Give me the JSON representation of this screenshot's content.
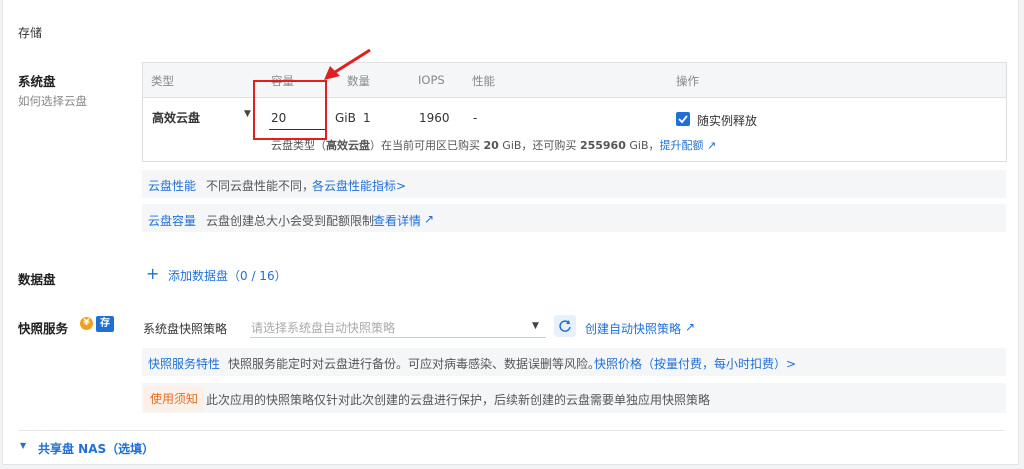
{
  "section": {
    "title": "存储"
  },
  "system_disk": {
    "label": "系统盘",
    "help_link": "如何选择云盘",
    "table": {
      "headers": [
        "类型",
        "容量",
        "数量",
        "IOPS",
        "性能",
        "操作"
      ],
      "row": {
        "type": "高效云盘",
        "capacity": "20",
        "unit": "GiB",
        "count": "1",
        "iops": "1960",
        "performance": "-",
        "release_checkbox_label": "随实例释放",
        "release_checked": true
      },
      "quota_text_prefix": "云盘类型（",
      "quota_disk_type": "高效云盘",
      "quota_text_mid1": "）在当前可用区已购买 ",
      "quota_purchased": "20",
      "quota_text_mid2": " GiB，还可购买 ",
      "quota_remaining": "255960",
      "quota_text_mid3": " GiB，",
      "quota_link": "提升配额"
    },
    "perf_bar": {
      "tag": "云盘性能",
      "text": "不同云盘性能不同，",
      "link": "各云盘性能指标>"
    },
    "capacity_bar": {
      "tag": "云盘容量",
      "text": "云盘创建总大小会受到配额限制 ",
      "link": "查看详情"
    }
  },
  "data_disk": {
    "label": "数据盘",
    "add_label": "添加数据盘（0 / 16）"
  },
  "snapshot": {
    "label": "快照服务",
    "badge_yen": "¥",
    "badge_store": "存",
    "policy_label": "系统盘快照策略",
    "policy_placeholder": "请选择系统盘自动快照策略",
    "create_link": "创建自动快照策略",
    "feature_bar": {
      "tag": "快照服务特性",
      "text": "快照服务能定时对云盘进行备份。可应对病毒感染、数据误删等风险。",
      "link": "快照价格（按量付费，每小时扣费）>"
    },
    "notice_bar": {
      "tag": "使用须知",
      "text": "此次应用的快照策略仅针对此次创建的云盘进行保护，后续新创建的云盘需要单独应用快照策略"
    }
  },
  "nas": {
    "label": "共享盘 NAS（选填）"
  },
  "colors": {
    "accent": "#1f6fd6",
    "highlight": "#e02020",
    "warning": "#e46e28"
  }
}
